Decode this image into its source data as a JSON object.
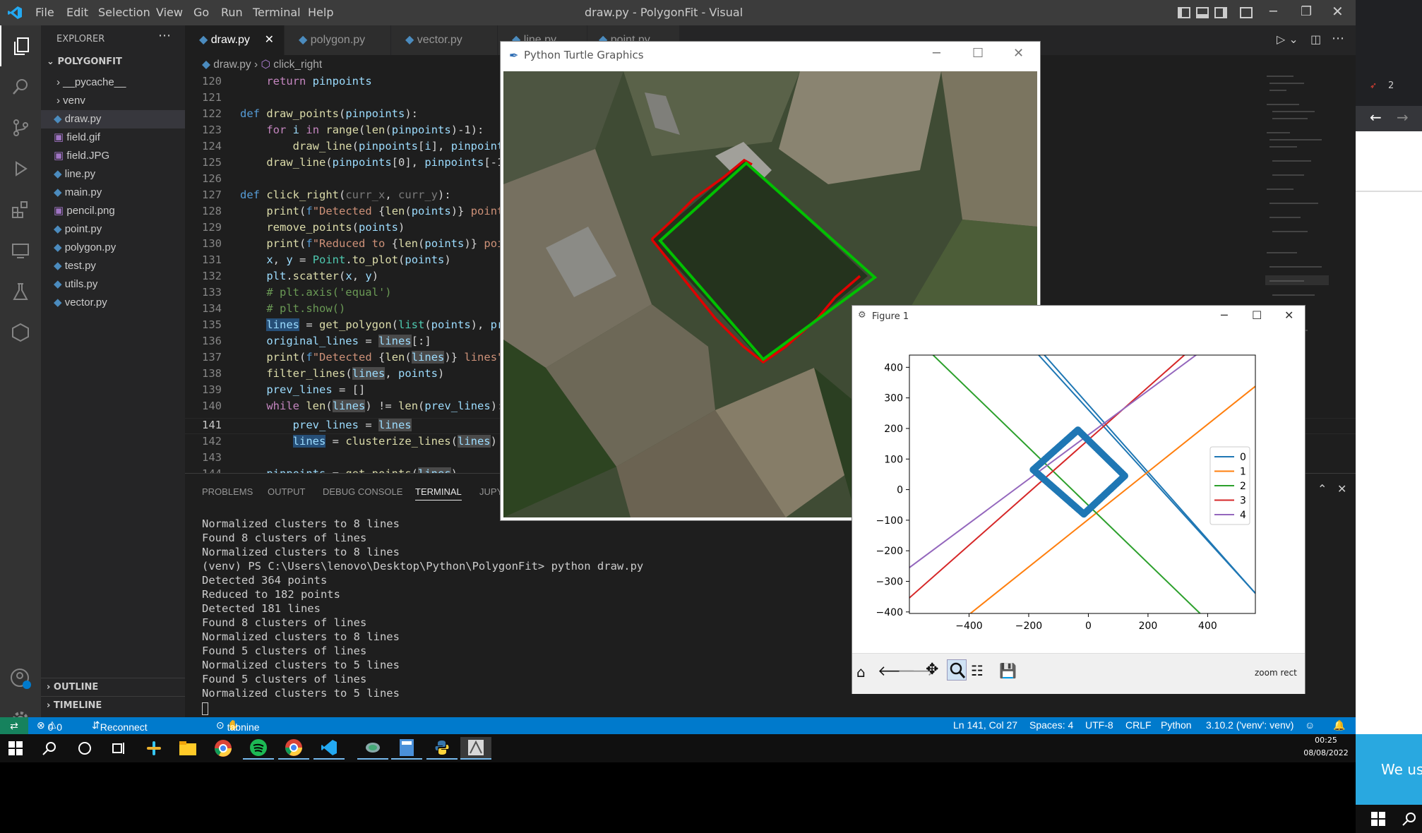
{
  "window": {
    "title": "draw.py - PolygonFit - Visual Studio Code"
  },
  "menu": [
    "File",
    "Edit",
    "Selection",
    "View",
    "Go",
    "Run",
    "Terminal",
    "Help"
  ],
  "explorer": {
    "header": "EXPLORER",
    "project": "POLYGONFIT",
    "files": [
      "__pycache__",
      "venv",
      "draw.py",
      "field.gif",
      "field.JPG",
      "line.py",
      "main.py",
      "pencil.png",
      "point.py",
      "polygon.py",
      "test.py",
      "utils.py",
      "vector.py"
    ],
    "outline": "OUTLINE",
    "timeline": "TIMELINE"
  },
  "tabs": [
    "draw.py",
    "polygon.py",
    "vector.py",
    "line.py",
    "point.py"
  ],
  "breadcrumb": {
    "file": "draw.py",
    "symbol": "click_right"
  },
  "editor": {
    "line_numbers": [
      "120",
      "121",
      "122",
      "123",
      "124",
      "125",
      "126",
      "127",
      "128",
      "129",
      "130",
      "131",
      "132",
      "133",
      "134",
      "135",
      "136",
      "137",
      "138",
      "139",
      "140",
      "141",
      "142",
      "143",
      "144"
    ]
  },
  "panel": {
    "tabs": [
      "PROBLEMS",
      "OUTPUT",
      "DEBUG CONSOLE",
      "TERMINAL",
      "JUPY"
    ],
    "terminal": [
      "Normalized clusters to 8 lines",
      "Found 8 clusters of lines",
      "Normalized clusters to 8 lines",
      "(venv) PS C:\\Users\\lenovo\\Desktop\\Python\\PolygonFit> python draw.py",
      "Detected 364 points",
      "Reduced to 182 points",
      "Detected 181 lines",
      "Found 8 clusters of lines",
      "Normalized clusters to 8 lines",
      "Found 5 clusters of lines",
      "Normalized clusters to 5 lines",
      "Found 5 clusters of lines",
      "Normalized clusters to 5 lines"
    ]
  },
  "status": {
    "errors": "0",
    "warnings": "0",
    "discord": "Reconnect to Discord",
    "tabnine": "tabnine starter",
    "position": "Ln 141, Col 27",
    "spaces": "Spaces: 4",
    "encoding": "UTF-8",
    "eol": "CRLF",
    "language": "Python",
    "interpreter": "3.10.2 ('venv': venv)"
  },
  "taskbar": {
    "time": "00:25",
    "date": "08/08/2022"
  },
  "turtle": {
    "title": "Python Turtle Graphics"
  },
  "figure": {
    "title": "Figure 1",
    "mode": "zoom rect"
  },
  "right_strip": {
    "badge": "2",
    "text": "We us"
  },
  "colors": {
    "accent": "#007acc",
    "series": [
      "#1f77b4",
      "#ff7f0e",
      "#2ca02c",
      "#d62728",
      "#9467bd"
    ]
  },
  "chart_data": {
    "type": "line",
    "xlim": [
      -600,
      560
    ],
    "ylim": [
      -405,
      440
    ],
    "xticks": [
      "−400",
      "−200",
      "0",
      "200",
      "400"
    ],
    "yticks": [
      "400",
      "300",
      "200",
      "100",
      "0",
      "−100",
      "−200",
      "−300",
      "−400"
    ],
    "legend": [
      "0",
      "1",
      "2",
      "3",
      "4"
    ],
    "legend_position": "right",
    "series": [
      {
        "name": "0",
        "x": [
          -600,
          560
        ],
        "y": [
          905,
          -339
        ]
      },
      {
        "name": "0",
        "x": [
          -320,
          560
        ],
        "y": [
          630,
          -339
        ]
      },
      {
        "name": "1",
        "x": [
          -600,
          560
        ],
        "y": [
          -564,
          338
        ]
      },
      {
        "name": "2",
        "x": [
          -600,
          560
        ],
        "y": [
          515,
          -580
        ]
      },
      {
        "name": "3",
        "x": [
          -600,
          560
        ],
        "y": [
          -354,
          645
        ]
      },
      {
        "name": "4",
        "x": [
          -600,
          560
        ],
        "y": [
          -255,
          584
        ]
      }
    ],
    "scatter_polygon": {
      "x": [
        -35,
        122,
        -15,
        -185,
        -35
      ],
      "y": [
        195,
        45,
        -80,
        65,
        195
      ]
    }
  }
}
